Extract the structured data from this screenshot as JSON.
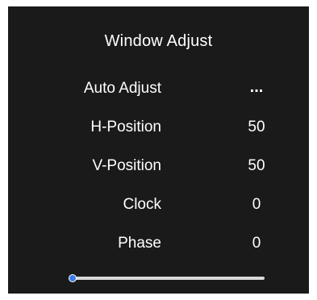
{
  "menu": {
    "title": "Window Adjust",
    "items": [
      {
        "label": "Auto Adjust",
        "value": "..."
      },
      {
        "label": "H-Position",
        "value": "50"
      },
      {
        "label": "V-Position",
        "value": "50"
      },
      {
        "label": "Clock",
        "value": "0"
      },
      {
        "label": "Phase",
        "value": "0"
      }
    ]
  },
  "slider": {
    "level": 0
  },
  "colors": {
    "background": "#1a1a1a",
    "text": "#ffffff",
    "accent": "#3d7be8",
    "track": "#d9d9d9"
  }
}
